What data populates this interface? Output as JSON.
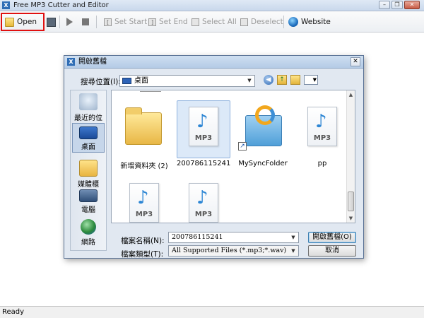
{
  "window": {
    "title": "Free MP3 Cutter and Editor",
    "app_icon": "X"
  },
  "toolbar": {
    "open_label": "Open",
    "set_start_label": "Set Start",
    "set_end_label": "Set End",
    "select_all_label": "Select All",
    "deselect_label": "Deselect",
    "website_label": "Website"
  },
  "status": {
    "text": "Ready"
  },
  "dialog": {
    "title": "開啟舊檔",
    "look_in_label": "搜尋位置(I):",
    "look_in_value": "桌面",
    "places": [
      {
        "label": "最近的位置"
      },
      {
        "label": "桌面"
      },
      {
        "label": "媒體櫃"
      },
      {
        "label": "電腦"
      },
      {
        "label": "網路"
      }
    ],
    "files": [
      {
        "name": "新增資料夾 (2)",
        "type": "folder"
      },
      {
        "name": "200786115241",
        "type": "mp3"
      },
      {
        "name": "MySyncFolder",
        "type": "sync-folder"
      },
      {
        "name": "pp",
        "type": "mp3"
      },
      {
        "name": "",
        "type": "mp3"
      },
      {
        "name": "",
        "type": "mp3"
      }
    ],
    "mp3_text": "MP3",
    "filename_label": "檔案名稱(N):",
    "filename_value": "200786115241",
    "filetype_label": "檔案類型(T):",
    "filetype_value": "All Supported Files (*.mp3;*.wav)",
    "open_button": "開啟舊檔(O)",
    "cancel_button": "取消"
  }
}
